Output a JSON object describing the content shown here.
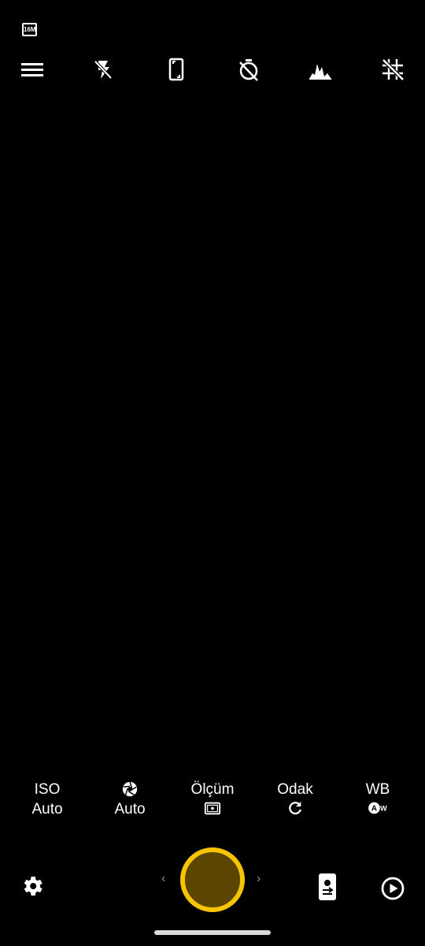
{
  "status": {
    "megapixel_badge": "16M"
  },
  "topbar": {
    "icons": [
      "menu-icon",
      "flash-off-icon",
      "aspect-ratio-icon",
      "timer-off-icon",
      "histogram-icon",
      "grid-off-icon"
    ]
  },
  "controls": {
    "iso": {
      "label": "ISO",
      "value": "Auto"
    },
    "shutter": {
      "icon": "aperture-icon",
      "value": "Auto"
    },
    "metering": {
      "label": "Ölçüm",
      "icon": "metering-icon"
    },
    "focus": {
      "label": "Odak",
      "icon": "refresh-icon"
    },
    "wb": {
      "label": "WB",
      "icon": "auto-wb-icon"
    }
  },
  "bottom": {
    "left_chevron": "‹",
    "right_chevron": "›",
    "icons": [
      "settings-icon",
      "shutter-button",
      "switch-camera-icon",
      "play-icon"
    ]
  },
  "colors": {
    "accent": "#f6c400",
    "shutter_fill": "#5b4500",
    "background": "#000000"
  }
}
